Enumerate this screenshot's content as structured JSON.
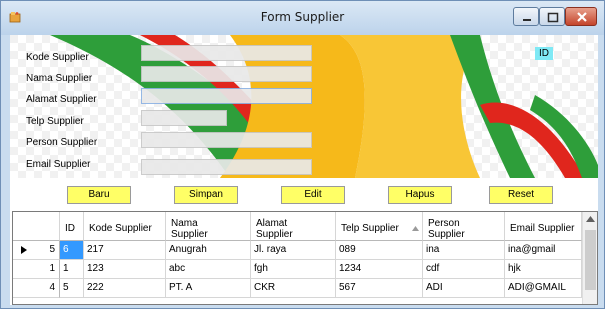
{
  "window": {
    "title": "Form Supplier"
  },
  "form": {
    "labels": {
      "kode": "Kode Supplier",
      "nama": "Nama Supplier",
      "alamat": "Alamat Supplier",
      "telp": "Telp Supplier",
      "person": "Person Supplier",
      "email": "Email Supplier"
    },
    "values": {
      "kode": "",
      "nama": "",
      "alamat": "",
      "telp": "",
      "person": "",
      "email": ""
    },
    "id_label": "ID"
  },
  "buttons": {
    "baru": "Baru",
    "simpan": "Simpan",
    "edit": "Edit",
    "hapus": "Hapus",
    "reset": "Reset"
  },
  "grid": {
    "columns": [
      "ID",
      "Kode Supplier",
      "Nama Supplier",
      "Alamat Supplier",
      "Telp Supplier",
      "Person Supplier",
      "Email Supplier"
    ],
    "sort_column": "Telp Supplier",
    "rows": [
      {
        "row_no": "5",
        "id": "6",
        "kode": "217",
        "nama": "Anugrah",
        "alamat": "Jl. raya",
        "telp": "089",
        "person": "ina",
        "email": "ina@gmail",
        "current": true
      },
      {
        "row_no": "1",
        "id": "1",
        "kode": "123",
        "nama": "abc",
        "alamat": "fgh",
        "telp": "1234",
        "person": "cdf",
        "email": "hjk",
        "current": false
      },
      {
        "row_no": "4",
        "id": "5",
        "kode": "222",
        "nama": "PT. A",
        "alamat": "CKR",
        "telp": "567",
        "person": "ADI",
        "email": "ADI@GMAIL",
        "current": false
      }
    ]
  },
  "colors": {
    "button_bg": "#ffff66",
    "selection": "#3399ff",
    "id_label_bg": "#7fe9f5",
    "art_yellow": "#f6b91a",
    "art_green": "#2e9e3a",
    "art_red": "#e0261d"
  }
}
